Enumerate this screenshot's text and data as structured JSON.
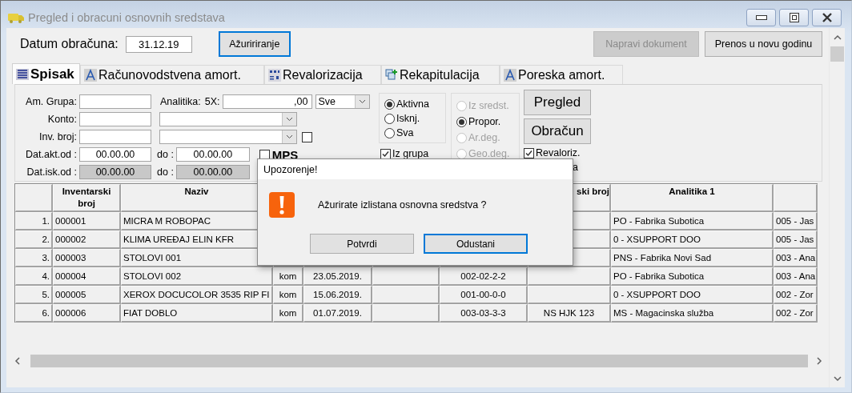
{
  "window": {
    "title": "Pregled i obracuni osnovnih sredstava"
  },
  "header": {
    "date_label": "Datum obračuna:",
    "date_value": "31.12.19",
    "update_button": {
      "label": "Ažuririranje",
      "focused": true
    },
    "buttons": [
      {
        "label": "Napravi dokument",
        "disabled": true
      },
      {
        "label": "Prenos u novu godinu",
        "disabled": false
      }
    ]
  },
  "tabs": [
    {
      "label": "Spisak",
      "selected": true,
      "kind": "list"
    },
    {
      "label": "Računovodstvena amort.",
      "selected": false,
      "kind": "triangle"
    },
    {
      "label": "Revalorizacija",
      "selected": false,
      "kind": "grid"
    },
    {
      "label": "Rekapitulacija",
      "selected": false,
      "kind": "stack"
    },
    {
      "label": "Poreska amort.",
      "selected": false,
      "kind": "triangle"
    }
  ],
  "filters": {
    "am_grupa_label": "Am. Grupa:",
    "analitika_label": "Analitika:",
    "fivex_label": "5X:",
    "fivex_value": ",00",
    "select_value": "Sve",
    "konto_label": "Konto:",
    "inv_broj_label": "Inv. broj:",
    "inv_broj_checked": false,
    "dat_akt_label": "Dat.akt.od :",
    "dat_akt_from": "00.00.00",
    "dat_akt_do_label": "do :",
    "dat_akt_to": "00.00.00",
    "mps": {
      "label": "MPS",
      "checked": false
    },
    "dat_isk_label": "Dat.isk.od :",
    "dat_isk_from": "00.00.00",
    "dat_isk_do_label": "do :",
    "dat_isk_to": "00.00.00",
    "dat_isk_disabled": true
  },
  "status_options": [
    {
      "label": "Aktivna",
      "selected": true
    },
    {
      "label": "Isknj.",
      "selected": false
    },
    {
      "label": "Sva",
      "selected": false
    }
  ],
  "method_options": [
    {
      "label": "Iz sredst.",
      "selected": false,
      "disabled": true
    },
    {
      "label": "Propor.",
      "selected": true,
      "disabled": false
    },
    {
      "label": "Ar.deg.",
      "selected": false,
      "disabled": true
    },
    {
      "label": "Geo.deg.",
      "selected": false,
      "disabled": true
    }
  ],
  "action_buttons": [
    "Pregled",
    "Obračun"
  ],
  "checks": [
    {
      "label": "Iz grupa",
      "checked": true
    },
    {
      "label": "Revaloriz.",
      "checked": true
    }
  ],
  "cut_label": "a",
  "table": {
    "columns": [
      "",
      "Inventarski broj",
      "Naziv",
      "",
      "",
      "",
      "",
      "ski broj",
      "Analitika 1",
      ""
    ],
    "rows": [
      {
        "cells": [
          "1.",
          "000001",
          "MICRA M ROBOPAC",
          "",
          "",
          "",
          "",
          "",
          "PO - Fabrika Subotica",
          "005 - Jas"
        ]
      },
      {
        "cells": [
          "2.",
          "000002",
          "KLIMA UREĐAJ ELIN KFR",
          "",
          "",
          "",
          "",
          "",
          "0 - XSUPPORT DOO",
          "005 - Jas"
        ]
      },
      {
        "cells": [
          "3.",
          "000003",
          "STOLOVI 001",
          "",
          "",
          "",
          "",
          "",
          "PNS - Fabrika Novi Sad",
          "003 - Ana"
        ]
      },
      {
        "cells": [
          "4.",
          "000004",
          "STOLOVI 002",
          "kom",
          "23.05.2019.",
          "",
          "002-02-2-2",
          "",
          "PO - Fabrika Subotica",
          "003 - Ana"
        ]
      },
      {
        "cells": [
          "5.",
          "000005",
          "XEROX DOCUCOLOR 3535 RIP FI",
          "kom",
          "15.06.2019.",
          "",
          "001-00-0-0",
          "",
          "0 - XSUPPORT DOO",
          "002 - Zor"
        ]
      },
      {
        "cells": [
          "6.",
          "000006",
          "FIAT DOBLO",
          "kom",
          "01.07.2019.",
          "",
          "003-03-3-3",
          "NS HJK 123",
          "MS - Magacinska služba",
          "002 - Zor"
        ]
      }
    ]
  },
  "dialog": {
    "title": "Upozorenje!",
    "message": "Ažurirate izlistana osnovna sredstva ?",
    "buttons": [
      {
        "label": "Potvrdi",
        "focused": false
      },
      {
        "label": "Odustani",
        "focused": true
      }
    ]
  }
}
